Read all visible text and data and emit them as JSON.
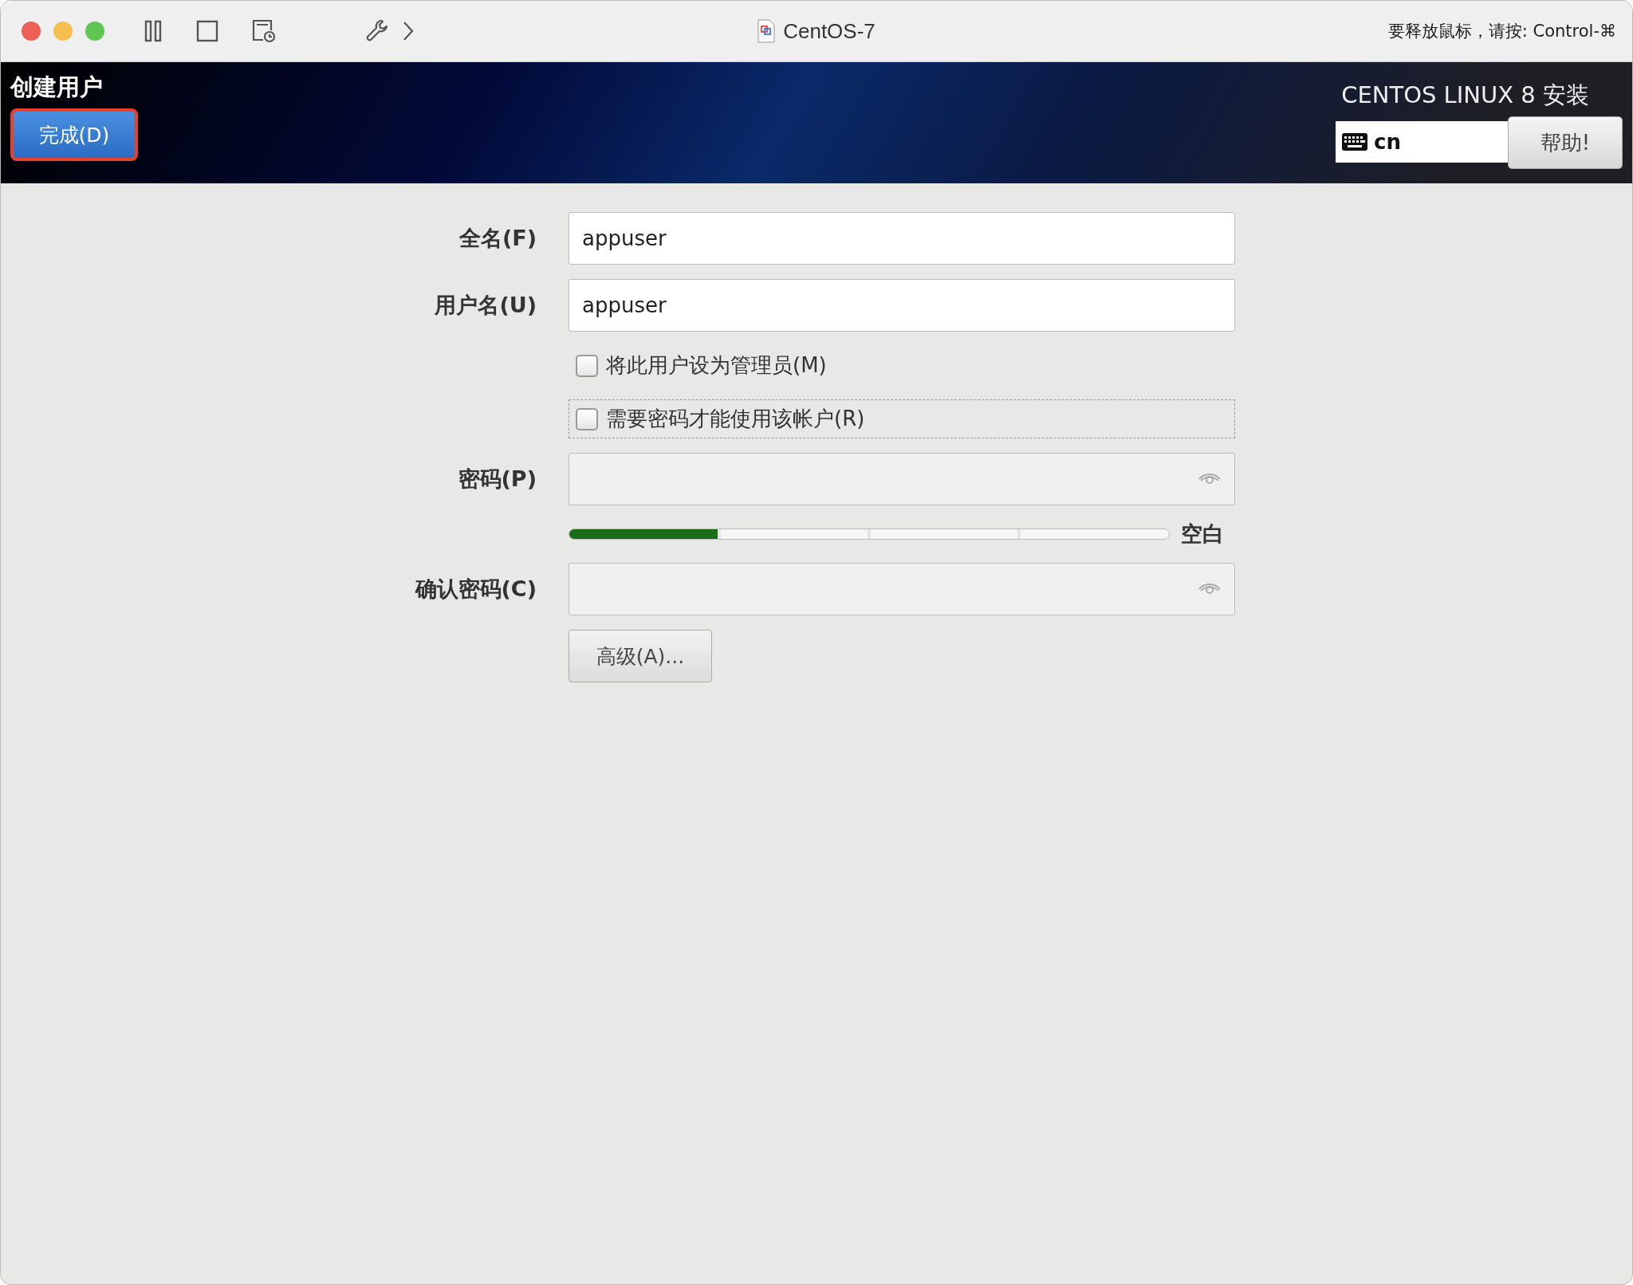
{
  "window": {
    "title": "CentOS-7",
    "hint": "要释放鼠标，请按: Control-⌘"
  },
  "header": {
    "title": "创建用户",
    "done_button": "完成(D)",
    "product": "CENTOS LINUX 8 安装",
    "keyboard_layout": "cn",
    "help_button": "帮助!"
  },
  "form": {
    "full_name": {
      "label": "全名(F)",
      "value": "appuser"
    },
    "username": {
      "label": "用户名(U)",
      "value": "appuser"
    },
    "checkboxes": [
      {
        "label": "将此用户设为管理员(M)",
        "checked": false,
        "focused": false
      },
      {
        "label": "需要密码才能使用该帐户(R)",
        "checked": false,
        "focused": true
      }
    ],
    "password": {
      "label": "密码(P)"
    },
    "strength": {
      "level": 0.25,
      "reading": "空白"
    },
    "confirm": {
      "label": "确认密码(C)"
    },
    "advanced_button": "高级(A)..."
  }
}
